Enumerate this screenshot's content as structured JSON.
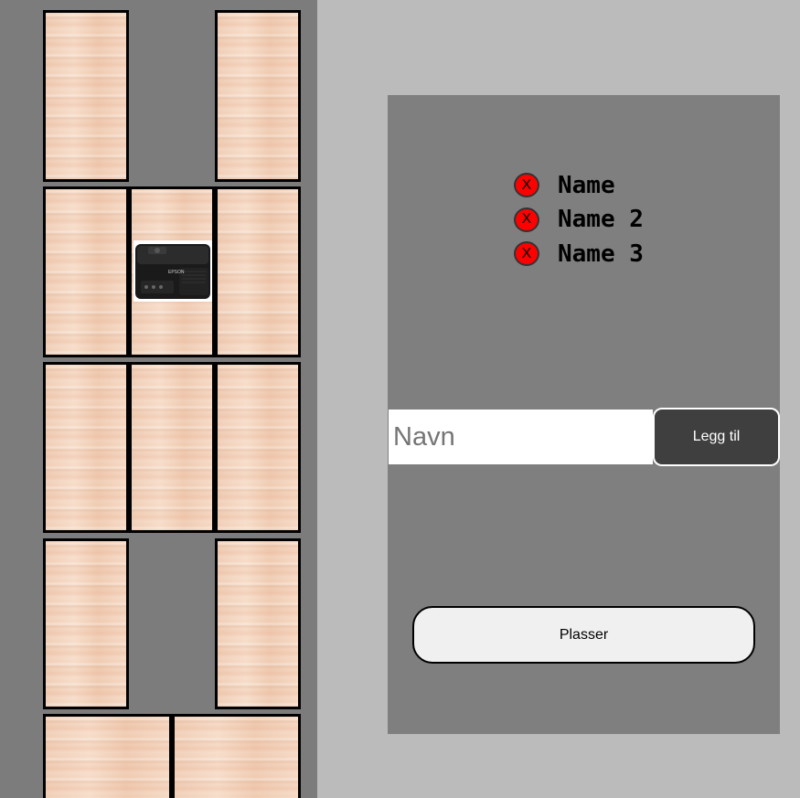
{
  "names": [
    {
      "label": "Name",
      "remove_label": "X"
    },
    {
      "label": "Name 2",
      "remove_label": "X"
    },
    {
      "label": "Name 3",
      "remove_label": "X"
    }
  ],
  "add_form": {
    "placeholder": "Navn",
    "value": "",
    "add_label": "Legg til"
  },
  "place_label": "Plasser",
  "projector_brand": "EPSON",
  "colors": {
    "map_background": "#7c7c7c",
    "page_background": "#bbbbbb",
    "panel_background": "#7f7f7f",
    "remove_button": "#ff0000",
    "add_button": "#3f3f3f",
    "place_button": "#f0f0f0"
  }
}
